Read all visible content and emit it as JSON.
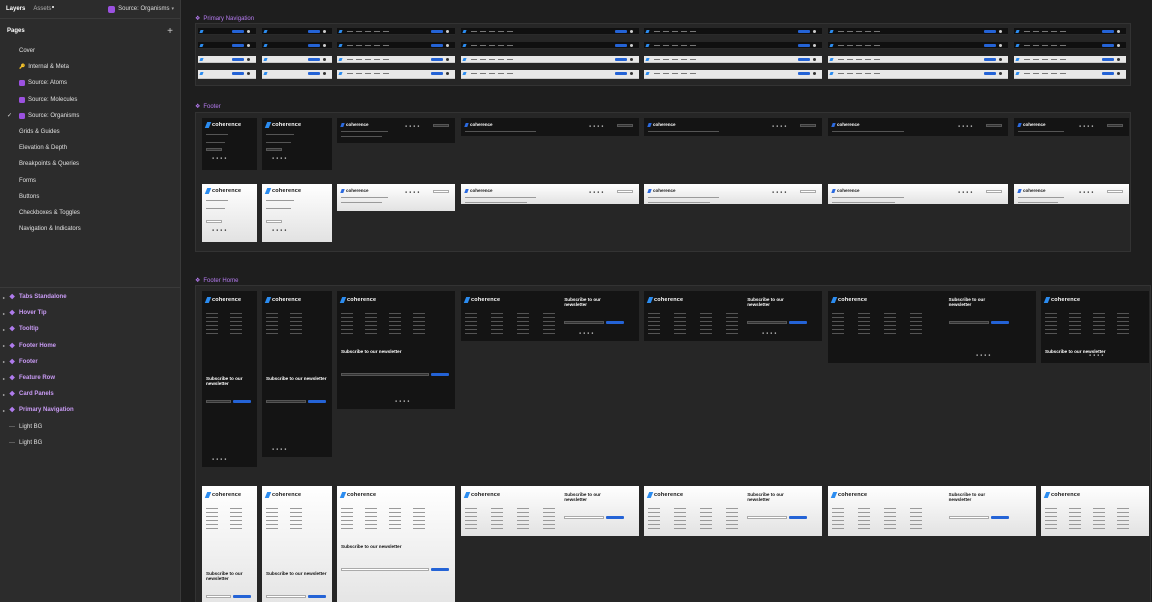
{
  "topbar": {
    "layers_tab": "Layers",
    "assets_tab": "Assets",
    "current_page": "Source: Organisms"
  },
  "pages": {
    "heading": "Pages",
    "items": [
      {
        "label": "Cover",
        "icon": "none"
      },
      {
        "label": "Internal & Meta",
        "icon": "key-icon"
      },
      {
        "label": "Source: Atoms",
        "icon": "purple-square-icon"
      },
      {
        "label": "Source: Molecules",
        "icon": "purple-square-icon"
      },
      {
        "label": "Source: Organisms",
        "icon": "purple-square-icon",
        "active": true
      },
      {
        "label": "Grids & Guides",
        "icon": "none"
      },
      {
        "label": "Elevation & Depth",
        "icon": "none"
      },
      {
        "label": "Breakpoints & Queries",
        "icon": "none"
      },
      {
        "label": "Forms",
        "icon": "none"
      },
      {
        "label": "Buttons",
        "icon": "none"
      },
      {
        "label": "Checkboxes & Toggles",
        "icon": "none"
      },
      {
        "label": "Navigation & Indicators",
        "icon": "none"
      }
    ]
  },
  "layers": [
    {
      "label": "Tabs Standalone",
      "type": "component-set"
    },
    {
      "label": "Hover Tip",
      "type": "component-set"
    },
    {
      "label": "Tooltip",
      "type": "component-set"
    },
    {
      "label": "Footer Home",
      "type": "component-set"
    },
    {
      "label": "Footer",
      "type": "component-set"
    },
    {
      "label": "Feature Row",
      "type": "component-set"
    },
    {
      "label": "Card Panels",
      "type": "component-set"
    },
    {
      "label": "Primary Navigation",
      "type": "component-set"
    },
    {
      "label": "Light BG",
      "type": "rectangle"
    },
    {
      "label": "Light BG",
      "type": "rectangle"
    }
  ],
  "canvas": {
    "sections": {
      "primary_nav": "Primary Navigation",
      "footer": "Footer",
      "footer_home": "Footer Home"
    },
    "brand": "coherence",
    "newsletter_title": "Subscribe to our newsletter"
  },
  "colors": {
    "accent_purple": "#9b51e0",
    "brand_blue": "#2463d6",
    "panel_bg": "#2c2c2c",
    "canvas_bg": "#1e1e1e"
  }
}
